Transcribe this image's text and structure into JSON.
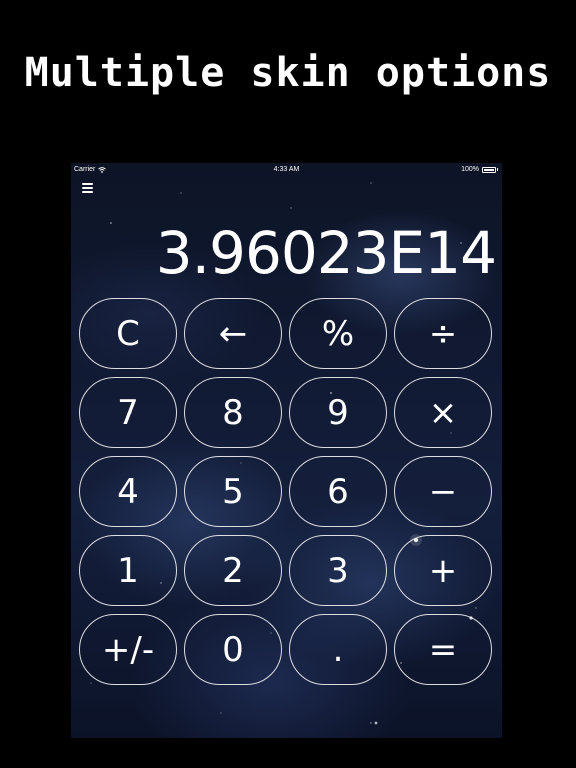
{
  "promo": {
    "heading": "Multiple skin options"
  },
  "status_bar": {
    "carrier": "Carrier",
    "time": "4:33 AM",
    "battery": "100%"
  },
  "calculator": {
    "display_value": "3.96023E14",
    "menu_icon": "hamburger-menu-icon",
    "keys": [
      {
        "label": "C",
        "name": "clear-button"
      },
      {
        "label": "←",
        "name": "backspace-button"
      },
      {
        "label": "%",
        "name": "percent-button"
      },
      {
        "label": "÷",
        "name": "divide-button"
      },
      {
        "label": "7",
        "name": "digit-7-button"
      },
      {
        "label": "8",
        "name": "digit-8-button"
      },
      {
        "label": "9",
        "name": "digit-9-button"
      },
      {
        "label": "×",
        "name": "multiply-button"
      },
      {
        "label": "4",
        "name": "digit-4-button"
      },
      {
        "label": "5",
        "name": "digit-5-button"
      },
      {
        "label": "6",
        "name": "digit-6-button"
      },
      {
        "label": "−",
        "name": "subtract-button"
      },
      {
        "label": "1",
        "name": "digit-1-button"
      },
      {
        "label": "2",
        "name": "digit-2-button"
      },
      {
        "label": "3",
        "name": "digit-3-button"
      },
      {
        "label": "+",
        "name": "add-button"
      },
      {
        "label": "+/-",
        "name": "sign-toggle-button"
      },
      {
        "label": "0",
        "name": "digit-0-button"
      },
      {
        "label": ".",
        "name": "decimal-button"
      },
      {
        "label": "=",
        "name": "equals-button"
      }
    ]
  },
  "colors": {
    "page_background": "#000000",
    "text": "#ffffff",
    "skin_base": "#111a33"
  }
}
